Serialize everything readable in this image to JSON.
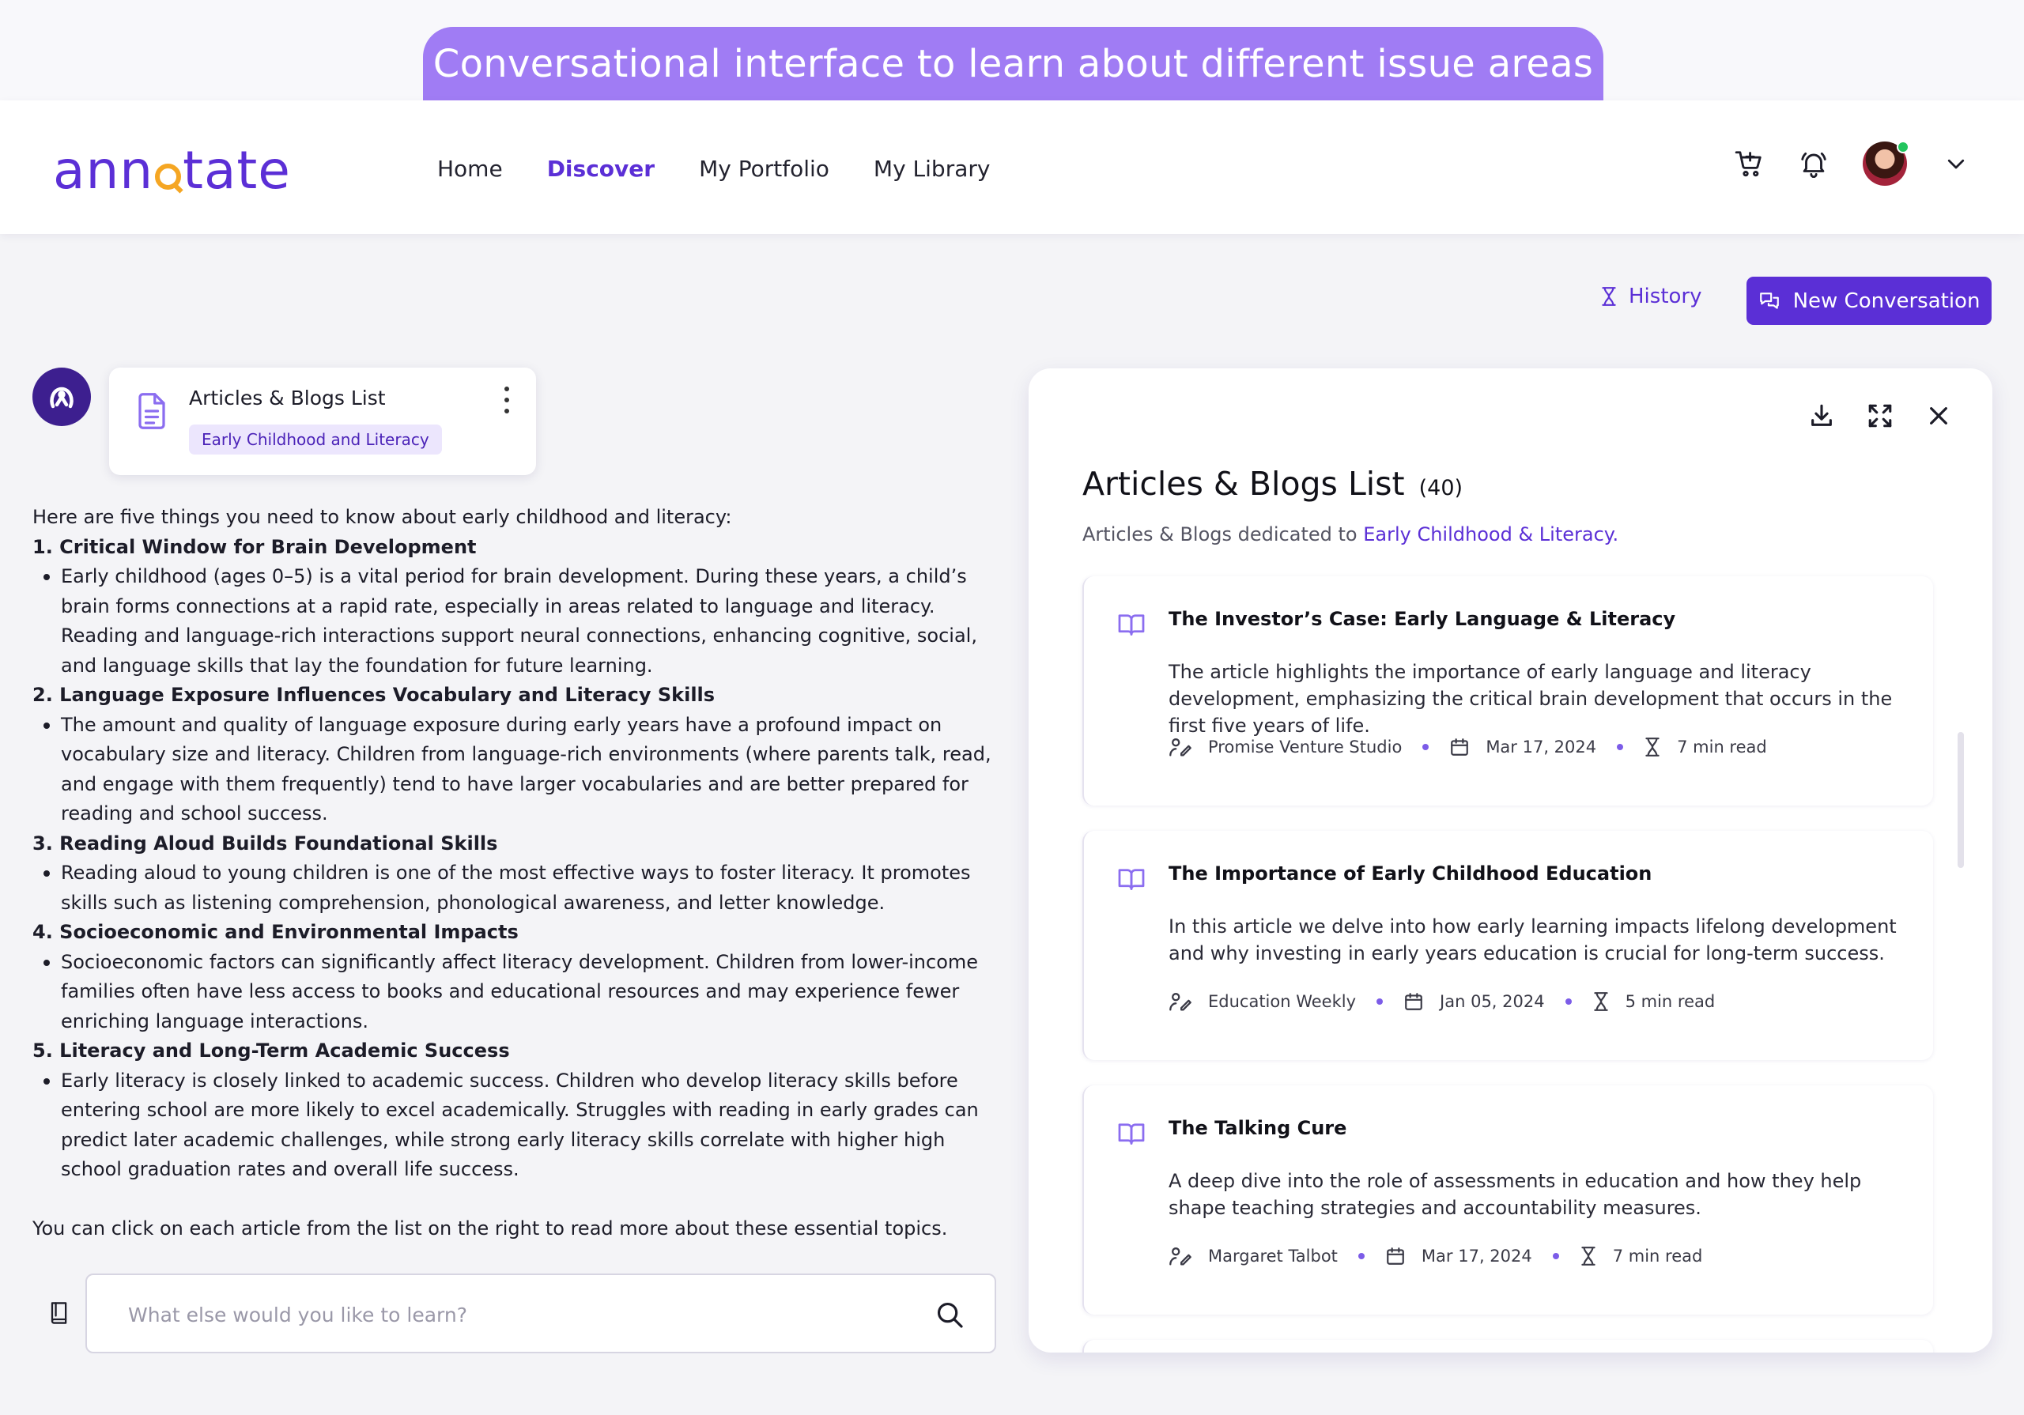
{
  "banner": {
    "text": "Conversational interface to learn about different issue areas"
  },
  "logo": {
    "before": "ann",
    "after": "tate"
  },
  "nav": {
    "items": [
      {
        "label": "Home",
        "active": false
      },
      {
        "label": "Discover",
        "active": true
      },
      {
        "label": "My Portfolio",
        "active": false
      },
      {
        "label": "My Library",
        "active": false
      }
    ],
    "icons": [
      "cart-icon",
      "bell-icon",
      "avatar",
      "chevron-down-icon"
    ]
  },
  "actions": {
    "history_label": "History",
    "new_conversation_label": "New Conversation"
  },
  "artifact": {
    "title": "Articles & Blogs List",
    "tag": "Early Childhood and Literacy"
  },
  "answer": {
    "intro": "Here are five things you need to know about early childhood and literacy:",
    "sections": [
      {
        "heading": "1. Critical Window for Brain Development",
        "body": "Early childhood (ages 0–5) is a vital period for brain development. During these years, a child’s brain forms connections at a rapid rate, especially in areas related to language and literacy. Reading and language-rich interactions support neural connections, enhancing cognitive, social, and language skills that lay the foundation for future learning."
      },
      {
        "heading": "2. Language Exposure Influences Vocabulary and Literacy Skills",
        "body": "The amount and quality of language exposure during early years have a profound impact on vocabulary size and literacy. Children from language-rich environments (where parents talk, read, and engage with them frequently) tend to have larger vocabularies and are better prepared for reading and school success."
      },
      {
        "heading": "3. Reading Aloud Builds Foundational Skills",
        "body": "Reading aloud to young children is one of the most effective ways to foster literacy. It promotes skills such as listening comprehension, phonological awareness, and letter knowledge."
      },
      {
        "heading": "4. Socioeconomic and Environmental Impacts",
        "body": "Socioeconomic factors can significantly affect literacy development. Children from lower-income families often have less access to books and educational resources and may experience fewer enriching language interactions."
      },
      {
        "heading": "5. Literacy and Long-Term Academic Success",
        "body": "Early literacy is closely linked to academic success. Children who develop literacy skills before entering school are more likely to excel academically. Struggles with reading in early grades can predict later academic challenges, while strong early literacy skills correlate with higher high school graduation rates and overall life success."
      }
    ],
    "outro": "You can click on each article from the list on the right to read more about these essential topics."
  },
  "chat": {
    "placeholder": "What else would you like to learn?"
  },
  "panel": {
    "title": "Articles & Blogs List",
    "count": "(40)",
    "subtitle_prefix": "Articles & Blogs dedicated to ",
    "subtitle_accent": "Early Childhood & Literacy.",
    "tools": [
      "download-icon",
      "expand-icon",
      "close-icon"
    ],
    "articles": [
      {
        "title": "The Investor’s Case: Early Language & Literacy",
        "description": "The article highlights the importance of early language and literacy development, emphasizing the critical brain development that occurs in the first five years of life.",
        "source": "Promise Venture Studio",
        "date": "Mar 17, 2024",
        "read_time": "7 min read"
      },
      {
        "title": "The Importance of Early Childhood Education",
        "description": "In this article we delve into how early learning impacts lifelong development and why investing in early years education is crucial for long-term success.",
        "source": "Education Weekly",
        "date": "Jan 05, 2024",
        "read_time": "5 min read"
      },
      {
        "title": "The Talking Cure",
        "description": "A deep dive into the role of assessments in education and how they help shape teaching strategies and accountability measures.",
        "source": "Margaret Talbot",
        "date": "Mar 17, 2024",
        "read_time": "7 min read"
      }
    ]
  },
  "colors": {
    "brand": "#5b2fd6",
    "banner": "#a07cf4",
    "logo_accent": "#f5a623",
    "online": "#22c55e"
  }
}
